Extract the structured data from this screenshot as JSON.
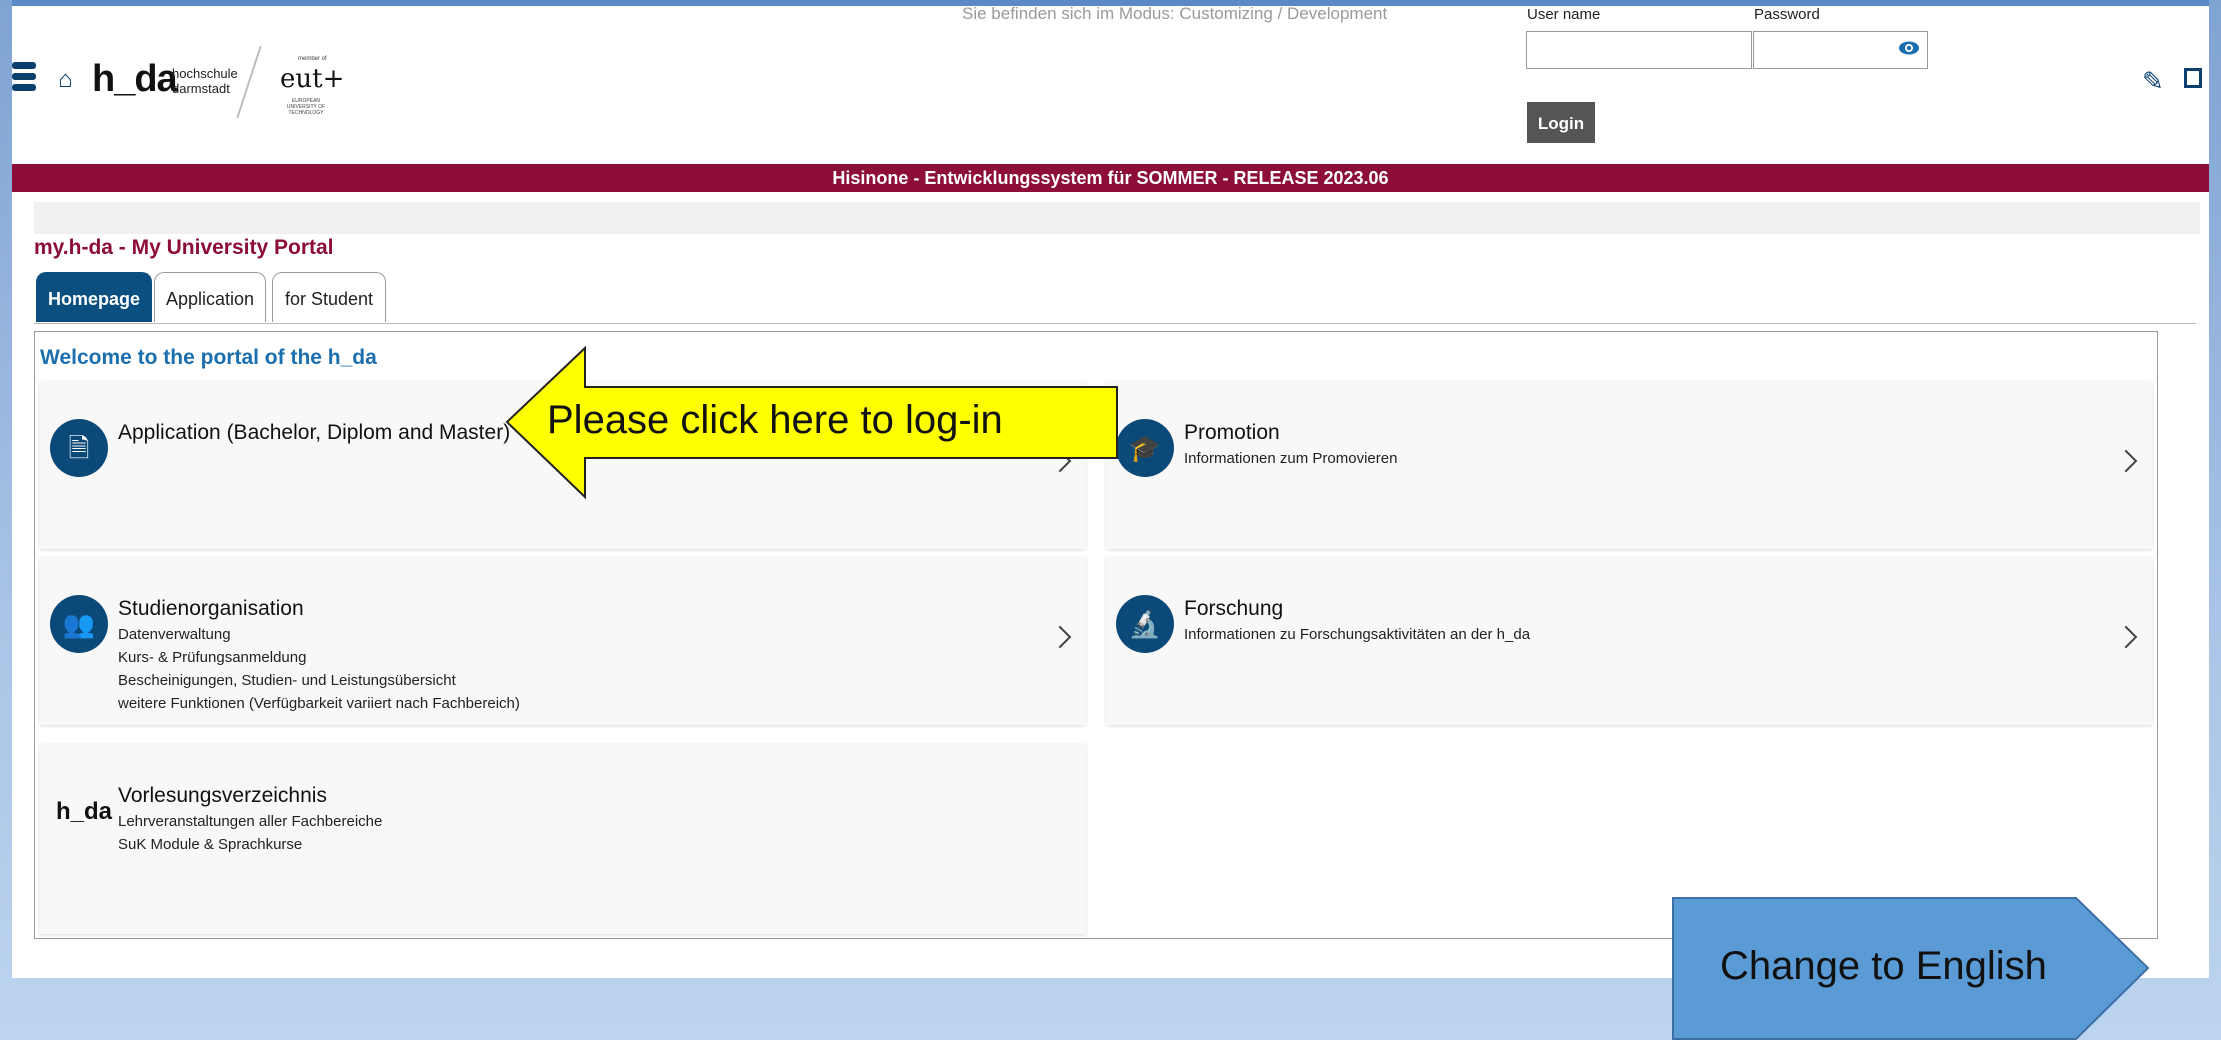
{
  "header": {
    "logo_text": "h_da",
    "logo_sub_line1": "hochschule",
    "logo_sub_line2": "darmstadt",
    "eut_small": "member of",
    "eut_main": "eut+",
    "eut_tiny": "EUROPEAN UNIVERSITY OF TECHNOLOGY",
    "mode_text": "Sie befinden sich im Modus: Customizing / Development",
    "username_label": "User name",
    "password_label": "Password",
    "username_value": "",
    "password_value": "",
    "login_label": "Login"
  },
  "banner": {
    "text": "Hisinone - Entwicklungssystem für SOMMER - RELEASE 2023.06"
  },
  "portal_title": "my.h-da - My University Portal",
  "tabs": [
    {
      "label": "Homepage",
      "active": true
    },
    {
      "label": "Application",
      "active": false
    },
    {
      "label": "for Student",
      "active": false
    }
  ],
  "welcome": "Welcome to the portal of the h_da",
  "cards": [
    {
      "title": "Application (Bachelor, Diplom and Master)",
      "lines": [],
      "icon": "document-icon"
    },
    {
      "title": "Promotion",
      "lines": [
        "Informationen zum Promovieren"
      ],
      "icon": "graduation-cap-icon"
    },
    {
      "title": "Studienorganisation",
      "lines": [
        "Datenverwaltung",
        "Kurs- & Prüfungsanmeldung",
        "Bescheinigungen, Studien- und Leistungsübersicht",
        "weitere Funktionen (Verfügbarkeit variiert nach Fachbereich)"
      ],
      "icon": "people-icon"
    },
    {
      "title": "Forschung",
      "lines": [
        "Informationen zu Forschungsaktivitäten an der h_da"
      ],
      "icon": "microscope-icon"
    },
    {
      "title": "Vorlesungsverzeichnis",
      "lines": [
        "Lehrveranstaltungen aller Fachbereiche",
        "SuK Module & Sprachkurse"
      ],
      "icon": "h_da"
    }
  ],
  "callouts": {
    "login_hint": "Please click here to log-in",
    "change_language": "Change to English"
  },
  "colors": {
    "banner": "#8c0d3a",
    "accent_blue": "#0b4a78",
    "arrow_yellow": "#ffff00",
    "callout_blue": "#5b9bd5"
  }
}
